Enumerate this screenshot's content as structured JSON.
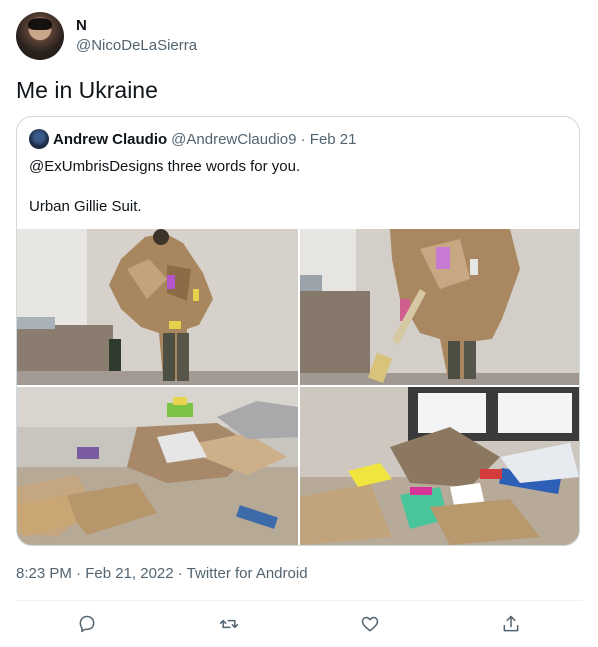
{
  "author": {
    "name": "N",
    "handle": "@NicoDeLaSierra"
  },
  "tweet": {
    "text": "Me in Ukraine"
  },
  "quoted": {
    "name": "Andrew Claudio",
    "meta": "@AndrewClaudio9 · Feb 21",
    "line1": "@ExUmbrisDesigns three words for you.",
    "line2": "Urban Gillie Suit."
  },
  "footer": {
    "meta": "8:23 PM · Feb 21, 2022 · Twitter for Android"
  },
  "icons": {
    "reply": "reply-icon",
    "retweet": "retweet-icon",
    "like": "like-icon",
    "share": "share-icon"
  },
  "colors": {
    "text": "#0f1419",
    "secondary": "#536471",
    "border": "#cfd9de"
  }
}
